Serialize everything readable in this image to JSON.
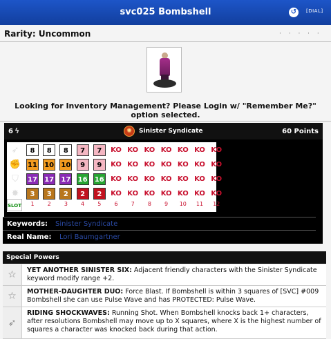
{
  "header": {
    "title": "svc025 Bombshell",
    "dial_link": "[DIAL]"
  },
  "rarity": "Rarity: Uncommon",
  "rating_dots": "· · · · ·",
  "login_notice": "Looking for Inventory Management? Please Login w/ \"Remember Me?\" option selected.",
  "dial": {
    "point_prefix": "6",
    "team": "Sinister Syndicate",
    "points": "60 Points",
    "rows": [
      {
        "stat": "speed",
        "icon": "boot-icon",
        "values": [
          "8",
          "8",
          "8",
          "7",
          "7",
          "KO",
          "KO",
          "KO",
          "KO",
          "KO",
          "KO",
          "KO"
        ],
        "colors": [
          "#fff",
          "#fff",
          "#fff",
          "#f4b6c2",
          "#f4b6c2",
          "",
          "",
          "",
          "",
          "",
          "",
          ""
        ]
      },
      {
        "stat": "attack",
        "icon": "fist-icon",
        "values": [
          "11",
          "10",
          "10",
          "9",
          "9",
          "KO",
          "KO",
          "KO",
          "KO",
          "KO",
          "KO",
          "KO"
        ],
        "colors": [
          "#f29b1f",
          "#f29b1f",
          "#f29b1f",
          "#f4b6c2",
          "#f4b6c2",
          "",
          "",
          "",
          "",
          "",
          "",
          ""
        ]
      },
      {
        "stat": "defense",
        "icon": "shield-icon",
        "values": [
          "17",
          "17",
          "17",
          "16",
          "16",
          "KO",
          "KO",
          "KO",
          "KO",
          "KO",
          "KO",
          "KO"
        ],
        "colors": [
          "#8a2bb5",
          "#8a2bb5",
          "#8a2bb5",
          "#27a532",
          "#27a532",
          "",
          "",
          "",
          "",
          "",
          "",
          ""
        ]
      },
      {
        "stat": "damage",
        "icon": "starburst-icon",
        "values": [
          "3",
          "3",
          "2",
          "2",
          "2",
          "KO",
          "KO",
          "KO",
          "KO",
          "KO",
          "KO",
          "KO"
        ],
        "colors": [
          "#b8761d",
          "#b8761d",
          "#b8761d",
          "#c1121f",
          "#c1121f",
          "",
          "",
          "",
          "",
          "",
          "",
          ""
        ]
      }
    ],
    "slot_label": "SLOT",
    "slots": [
      "1",
      "2",
      "3",
      "4",
      "5",
      "6",
      "7",
      "8",
      "9",
      "10",
      "11",
      "12"
    ]
  },
  "keywords": {
    "label": "Keywords:",
    "value": "Sinister Syndicate"
  },
  "real_name": {
    "label": "Real Name:",
    "value": "Lori Baumgartner"
  },
  "special_powers": {
    "heading": "Special Powers",
    "items": [
      {
        "icon": "star-icon",
        "name": "YET ANOTHER SINISTER SIX:",
        "text": "Adjacent friendly characters with the Sinister Syndicate keyword modify range +2."
      },
      {
        "icon": "star-icon",
        "name": "MOTHER-DAUGHTER DUO:",
        "text": "Force Blast. If Bombshell is within 3 squares of [SVC] #009 Bombshell she can use Pulse Wave and has PROTECTED: Pulse Wave."
      },
      {
        "icon": "boot-icon",
        "name": "RIDING SHOCKWAVES:",
        "text": "Running Shot. When Bombshell knocks back 1+ characters, after resolutions Bombshell may move up to X squares, where X is the highest number of squares a character was knocked back during that action."
      }
    ]
  }
}
